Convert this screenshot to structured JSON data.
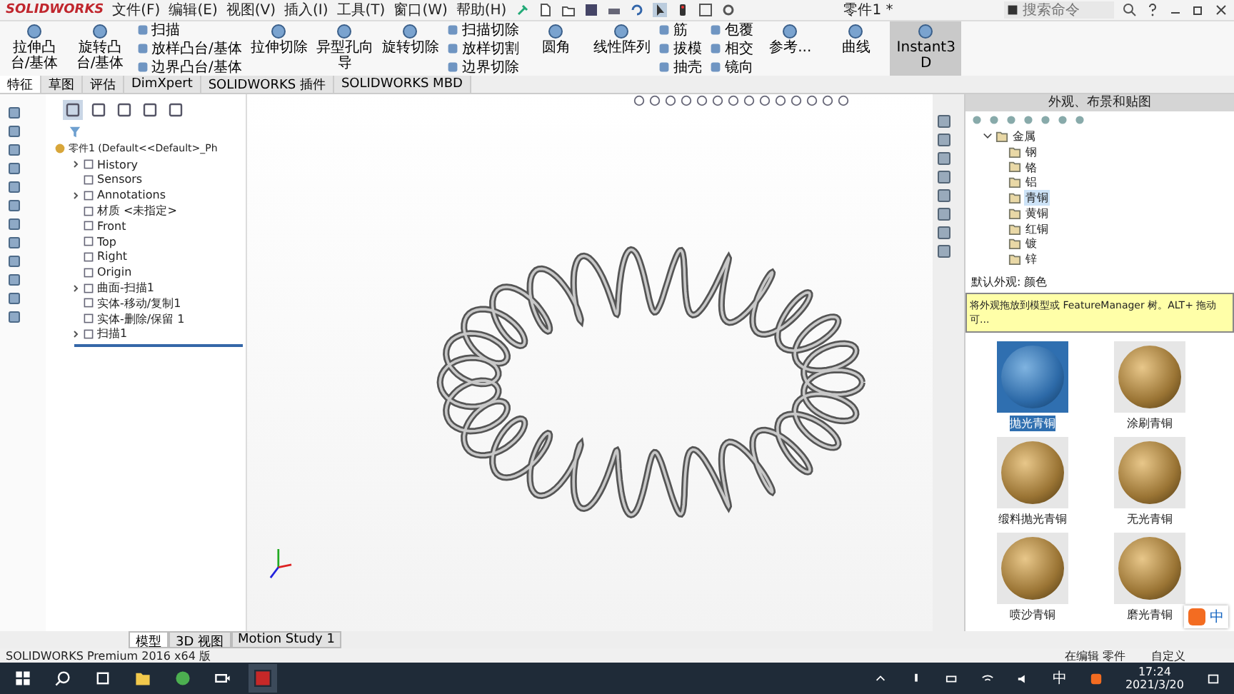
{
  "title_bar": {
    "logo": "SOLIDWORKS",
    "menus": [
      "文件(F)",
      "编辑(E)",
      "视图(V)",
      "插入(I)",
      "工具(T)",
      "窗口(W)",
      "帮助(H)"
    ],
    "document": "零件1 *",
    "search": {
      "placeholder": "搜索命令"
    }
  },
  "ribbon": [
    {
      "kind": "large",
      "label": "拉伸凸台/基体",
      "selected": false
    },
    {
      "kind": "large",
      "label": "旋转凸台/基体",
      "selected": false
    },
    {
      "kind": "stack",
      "items": [
        "扫描",
        "放样凸台/基体",
        "边界凸台/基体"
      ]
    },
    {
      "kind": "large",
      "label": "拉伸切除",
      "selected": false
    },
    {
      "kind": "large",
      "label": "异型孔向导",
      "selected": false
    },
    {
      "kind": "large",
      "label": "旋转切除",
      "selected": false
    },
    {
      "kind": "stack",
      "items": [
        "扫描切除",
        "放样切割",
        "边界切除"
      ]
    },
    {
      "kind": "large",
      "label": "圆角",
      "selected": false
    },
    {
      "kind": "large",
      "label": "线性阵列",
      "selected": false
    },
    {
      "kind": "stack",
      "items": [
        "筋",
        "拔模",
        "抽壳"
      ]
    },
    {
      "kind": "stack",
      "items": [
        "包覆",
        "相交",
        "镜向"
      ]
    },
    {
      "kind": "large",
      "label": "参考...",
      "selected": false
    },
    {
      "kind": "large",
      "label": "曲线",
      "selected": false
    },
    {
      "kind": "large",
      "label": "Instant3D",
      "selected": true
    }
  ],
  "command_tabs": [
    {
      "label": "特征",
      "selected": true
    },
    {
      "label": "草图",
      "selected": false
    },
    {
      "label": "评估",
      "selected": false
    },
    {
      "label": "DimXpert",
      "selected": false
    },
    {
      "label": "SOLIDWORKS 插件",
      "selected": false
    },
    {
      "label": "SOLIDWORKS MBD",
      "selected": false
    }
  ],
  "feature_tree": {
    "root": "零件1 (Default<<Default>_Ph",
    "items": [
      {
        "label": "History",
        "expander": true
      },
      {
        "label": "Sensors",
        "expander": false
      },
      {
        "label": "Annotations",
        "expander": true
      },
      {
        "label": "材质 <未指定>",
        "expander": false
      },
      {
        "label": "Front",
        "expander": false
      },
      {
        "label": "Top",
        "expander": false
      },
      {
        "label": "Right",
        "expander": false
      },
      {
        "label": "Origin",
        "expander": false
      },
      {
        "label": "曲面-扫描1",
        "expander": true
      },
      {
        "label": "实体-移动/复制1",
        "expander": false
      },
      {
        "label": "实体-删除/保留 1",
        "expander": false
      },
      {
        "label": "扫描1",
        "expander": true
      }
    ]
  },
  "appearance_panel": {
    "title": "外观、布景和贴图",
    "tree": [
      {
        "label": "金属",
        "expanded": true,
        "selected": false,
        "children": [
          {
            "label": "钢",
            "selected": false
          },
          {
            "label": "铬",
            "selected": false
          },
          {
            "label": "铝",
            "selected": false
          },
          {
            "label": "青铜",
            "selected": true
          },
          {
            "label": "黄铜",
            "selected": false
          },
          {
            "label": "红铜",
            "selected": false
          },
          {
            "label": "镀",
            "selected": false
          },
          {
            "label": "锌",
            "selected": false
          }
        ]
      }
    ],
    "default_appearance": "默认外观: 颜色",
    "tooltip": "将外观拖放到模型或 FeatureManager 树。ALT+ 拖动可...",
    "swatches": [
      {
        "label": "抛光青铜",
        "selected": true
      },
      {
        "label": "涂刷青铜",
        "selected": false
      },
      {
        "label": "缎料抛光青铜",
        "selected": false
      },
      {
        "label": "无光青铜",
        "selected": false
      },
      {
        "label": "喷沙青铜",
        "selected": false
      },
      {
        "label": "磨光青铜",
        "selected": false
      }
    ]
  },
  "ime_toolbar": {
    "mode": "中"
  },
  "bottom_tabs": [
    {
      "label": "模型",
      "selected": true
    },
    {
      "label": "3D 视图",
      "selected": false
    },
    {
      "label": "Motion Study 1",
      "selected": false
    }
  ],
  "status_bar": {
    "product": "SOLIDWORKS Premium 2016 x64 版",
    "mode": "在编辑 零件",
    "units": "自定义"
  },
  "taskbar": {
    "ime": "中",
    "time": "17:24",
    "date": "2021/3/20"
  }
}
